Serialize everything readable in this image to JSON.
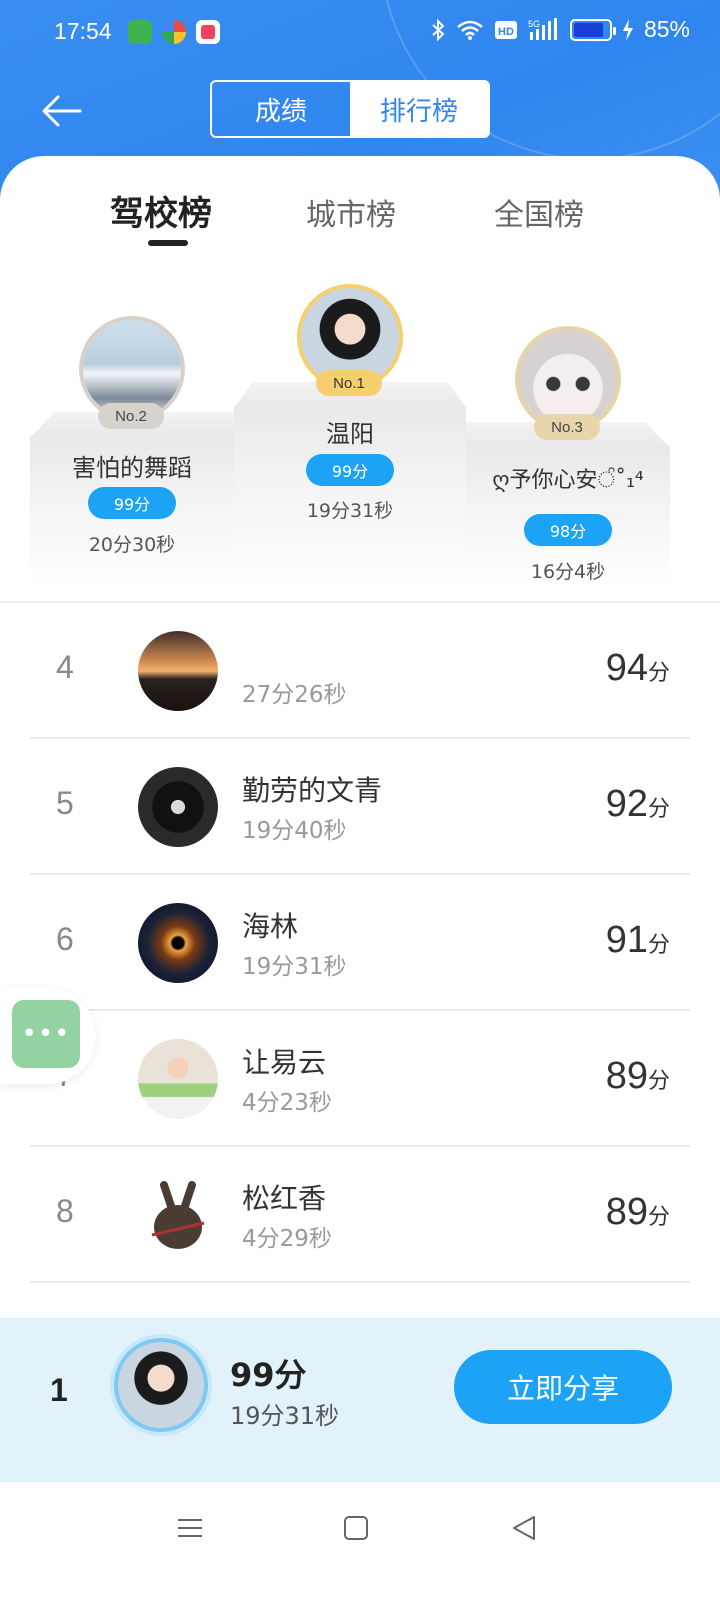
{
  "status_bar": {
    "time": "17:54",
    "battery": "85%",
    "battery_level": 0.85
  },
  "header": {
    "tab_score": "成绩",
    "tab_ranking": "排行榜"
  },
  "tabs": [
    "驾校榜",
    "城市榜",
    "全国榜"
  ],
  "podium": [
    {
      "rank_tag": "No.1",
      "name": "温阳",
      "score": "99分",
      "time": "19分31秒"
    },
    {
      "rank_tag": "No.2",
      "name": "害怕的舞蹈",
      "score": "99分",
      "time": "20分30秒"
    },
    {
      "rank_tag": "No.3",
      "name": "ღ予你心安ੰ˚₁⁴",
      "score": "98分",
      "time": "16分4秒"
    }
  ],
  "list": [
    {
      "rank": "4",
      "name": "",
      "time": "27分26秒",
      "score": "94",
      "unit": "分"
    },
    {
      "rank": "5",
      "name": "勤劳的文青",
      "time": "19分40秒",
      "score": "92",
      "unit": "分"
    },
    {
      "rank": "6",
      "name": "海林",
      "time": "19分31秒",
      "score": "91",
      "unit": "分"
    },
    {
      "rank": "7",
      "name": "让易云",
      "time": "4分23秒",
      "score": "89",
      "unit": "分"
    },
    {
      "rank": "8",
      "name": "松红香",
      "time": "4分29秒",
      "score": "89",
      "unit": "分"
    }
  ],
  "my_rank": {
    "rank": "1",
    "score": "99分",
    "time": "19分31秒",
    "share_label": "立即分享"
  },
  "colors": {
    "primary": "#2f86ee",
    "accent": "#1da3f5",
    "gold": "#f5cf6e",
    "float_button": "#93d3a2"
  }
}
